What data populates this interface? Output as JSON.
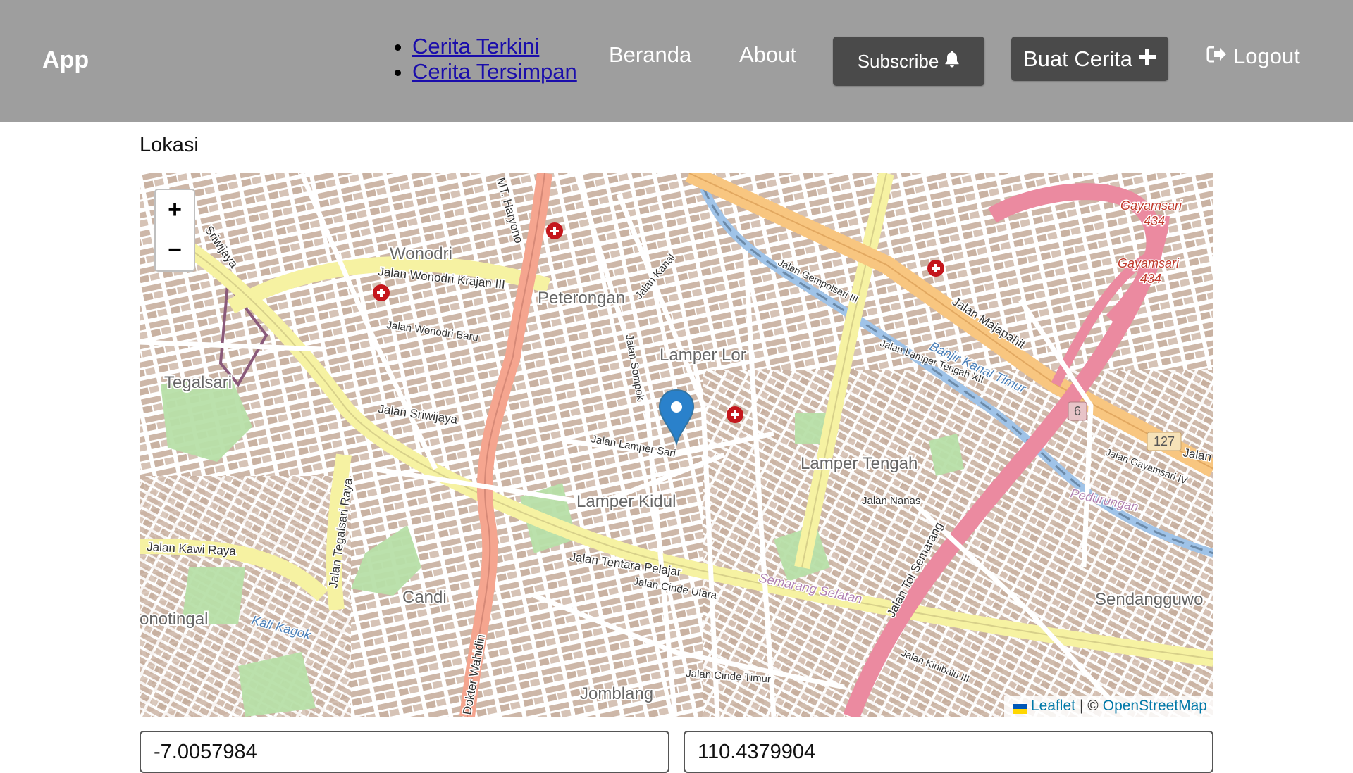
{
  "header": {
    "brand": "App",
    "story_menu": [
      "Cerita Terkini",
      "Cerita Tersimpan"
    ],
    "nav": {
      "home": "Beranda",
      "about": "About"
    },
    "subscribe_label": "Subscribe",
    "create_label": "Buat Cerita",
    "logout_label": "Logout",
    "icons": {
      "subscribe": "bell-icon",
      "create": "plus-icon",
      "logout": "sign-out-icon"
    }
  },
  "location": {
    "label": "Lokasi",
    "latitude": "-7.0057984",
    "longitude": "110.4379904"
  },
  "map": {
    "zoom_in": "+",
    "zoom_out": "−",
    "attribution": {
      "leaflet": "Leaflet",
      "separator": "| ©",
      "osm": "OpenStreetMap"
    },
    "places": {
      "wonodri": "Wonodri",
      "peterongan": "Peterongan",
      "lamper_lor": "Lamper Lor",
      "tegalsari": "Tegalsari",
      "lamper_tengah": "Lamper Tengah",
      "lamper_kidul": "Lamper Kidul",
      "candi": "Candi",
      "jomblang": "Jomblang",
      "sendangguwo": "Sendangguwo",
      "randusari": "onotingal",
      "gayamsari1": "Gayamsari",
      "gayamsari2": "Gayamsari",
      "num434a": "434",
      "num434b": "434",
      "semarang_selatan": "Semarang Selatan",
      "pedurungan": "Pedurungan",
      "kali_kagok": "Kali Kagok",
      "banjir_kanal": "Banjir Kanal Timur"
    },
    "streets": {
      "sriwijaya": "Jalan Sriwijaya",
      "wonodri_krajan": "Jalan Wonodri Krajan III",
      "wonodri_baru": "Jalan Wonodri Baru",
      "tentara_pelajar": "Jalan Tentara Pelajar",
      "kawi_raya": "Jalan Kawi Raya",
      "majapahit": "Jalan Majapahit",
      "tol": "Jalan Tol Semarang",
      "lamper_sari": "Jalan Lamper Sari",
      "nanas": "Jalan Nanas",
      "cinde_utara": "Jalan Cinde Utara",
      "cinde_timur": "Jalan Cinde Timur",
      "mt_haryono": "MT. Haryono",
      "dokter_wahidin": "Dokter Wahidin",
      "tegalsari_raya": "Jalan Tegalsari Raya",
      "kanal": "Jalan Kanal",
      "sompok": "Jalan Sompok",
      "gempolsari": "Jalan Gempolsari III",
      "lamper_tengah_xii": "Jalan Lamper Tengah XII",
      "gayamsari_iv": "Jalan Gayamsari IV",
      "kinibalu": "Jalan Kinibalu III",
      "jalan_edge": "Jalan",
      "route6": "6",
      "route127": "127",
      "sriwijaya_edge": "Sriwijaya"
    },
    "marker_icon": "map-marker-icon",
    "hospital_icon": "hospital-icon"
  }
}
